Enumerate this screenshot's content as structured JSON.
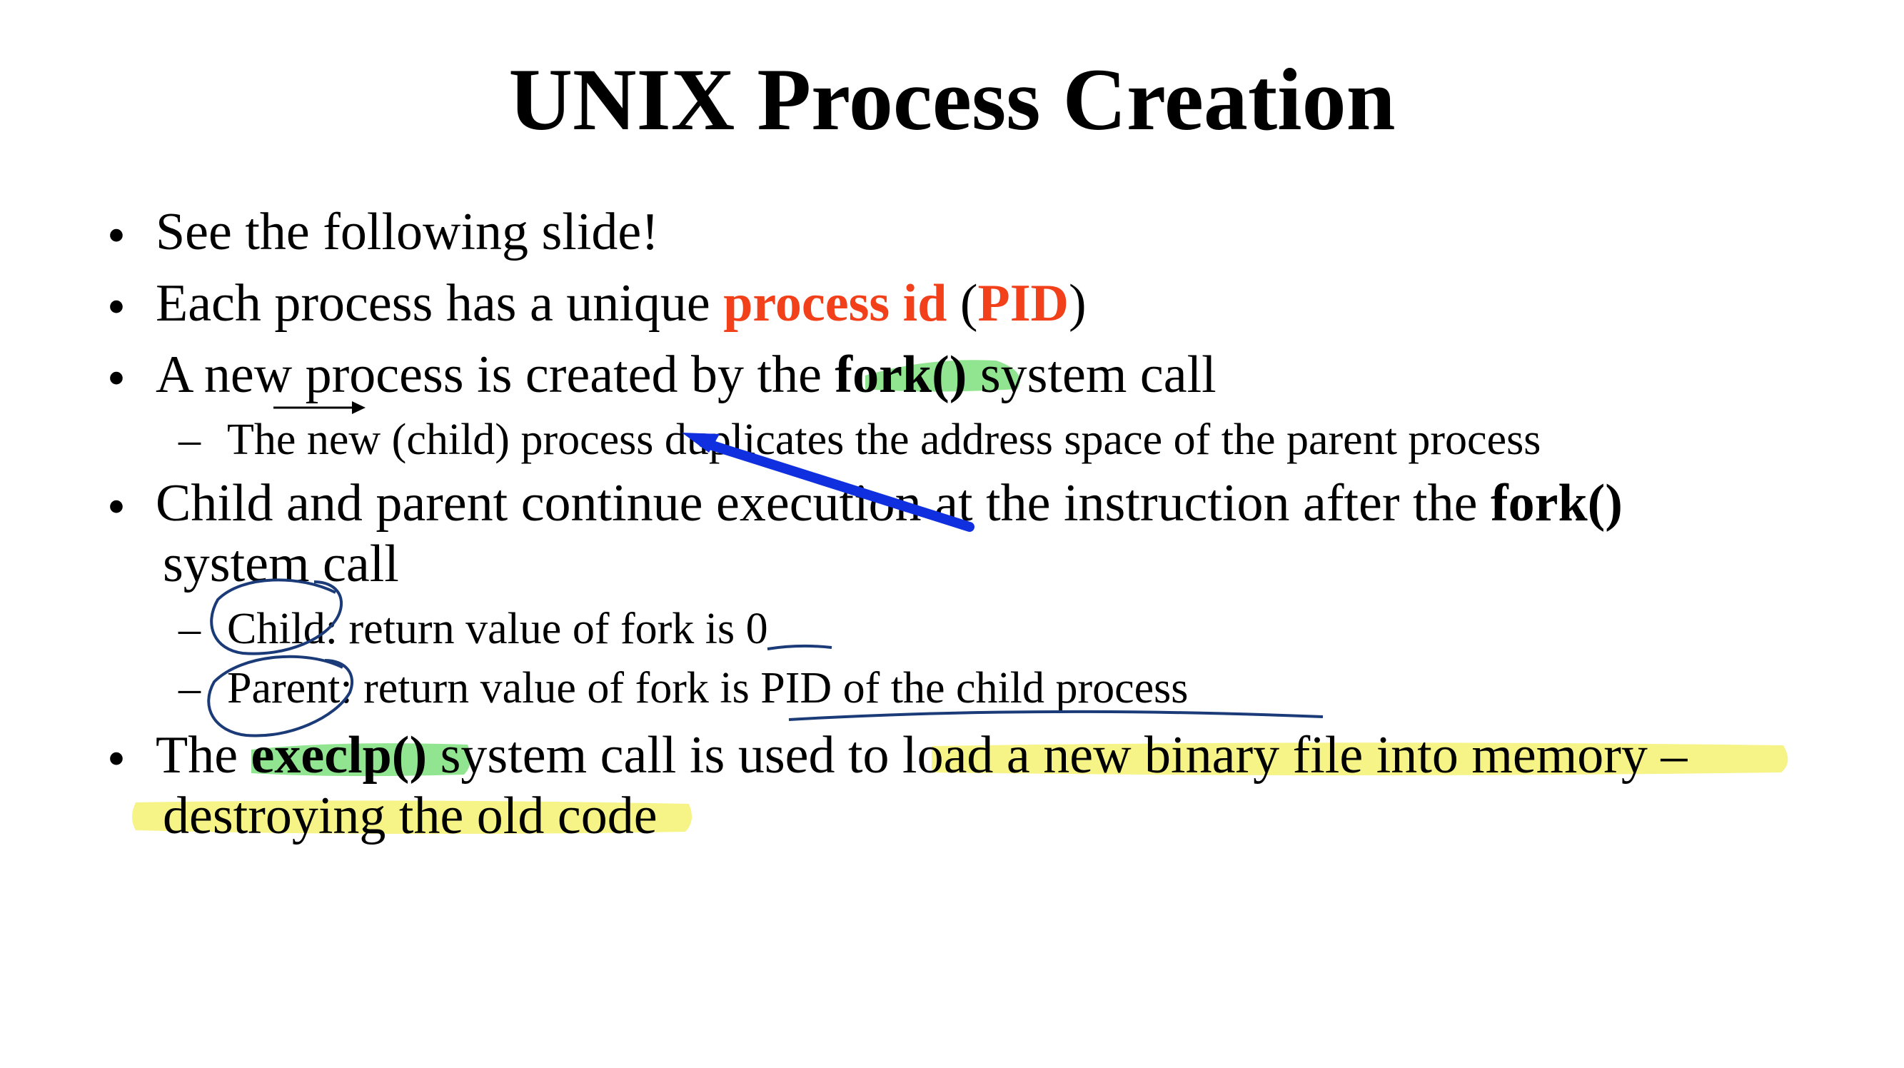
{
  "slide": {
    "title": "UNIX Process Creation",
    "bullet_glyph": "•",
    "dash_glyph": "–",
    "items": [
      {
        "text": "See the following slide!"
      },
      {
        "pre": "Each process has a unique ",
        "accent1": "process id",
        "mid": " (",
        "accent2": "PID",
        "post": ")"
      },
      {
        "pre": "A new process is created by the ",
        "code": "fork()",
        "post": " system call"
      },
      {
        "text": "The new (child) process duplicates the address space of the parent process"
      },
      {
        "pre": "Child and parent continue execution at the instruction after the ",
        "code": "fork()",
        "cont": "system call"
      },
      {
        "text": "Child: return value of fork is 0"
      },
      {
        "text": "Parent: return value of fork is PID of the child process"
      },
      {
        "pre": "The ",
        "code": "execlp()",
        "post": " system call is used to load a new binary file into memory –",
        "cont": "destroying the old code"
      }
    ]
  },
  "colors": {
    "text": "#000000",
    "accent": "#f2401b",
    "highlight_green": "#7ee07e",
    "highlight_yellow": "#f5f27a",
    "ink_blue": "#1030e0",
    "ink_navy": "#1a3a78"
  },
  "annotations": {
    "green_highlight_icon": "highlighter-green",
    "yellow_highlight_icon": "highlighter-yellow",
    "pen_arrow_icon": "arrow-pen",
    "pen_circle_icon": "circle-pen",
    "pen_underline_icon": "underline-pen"
  }
}
